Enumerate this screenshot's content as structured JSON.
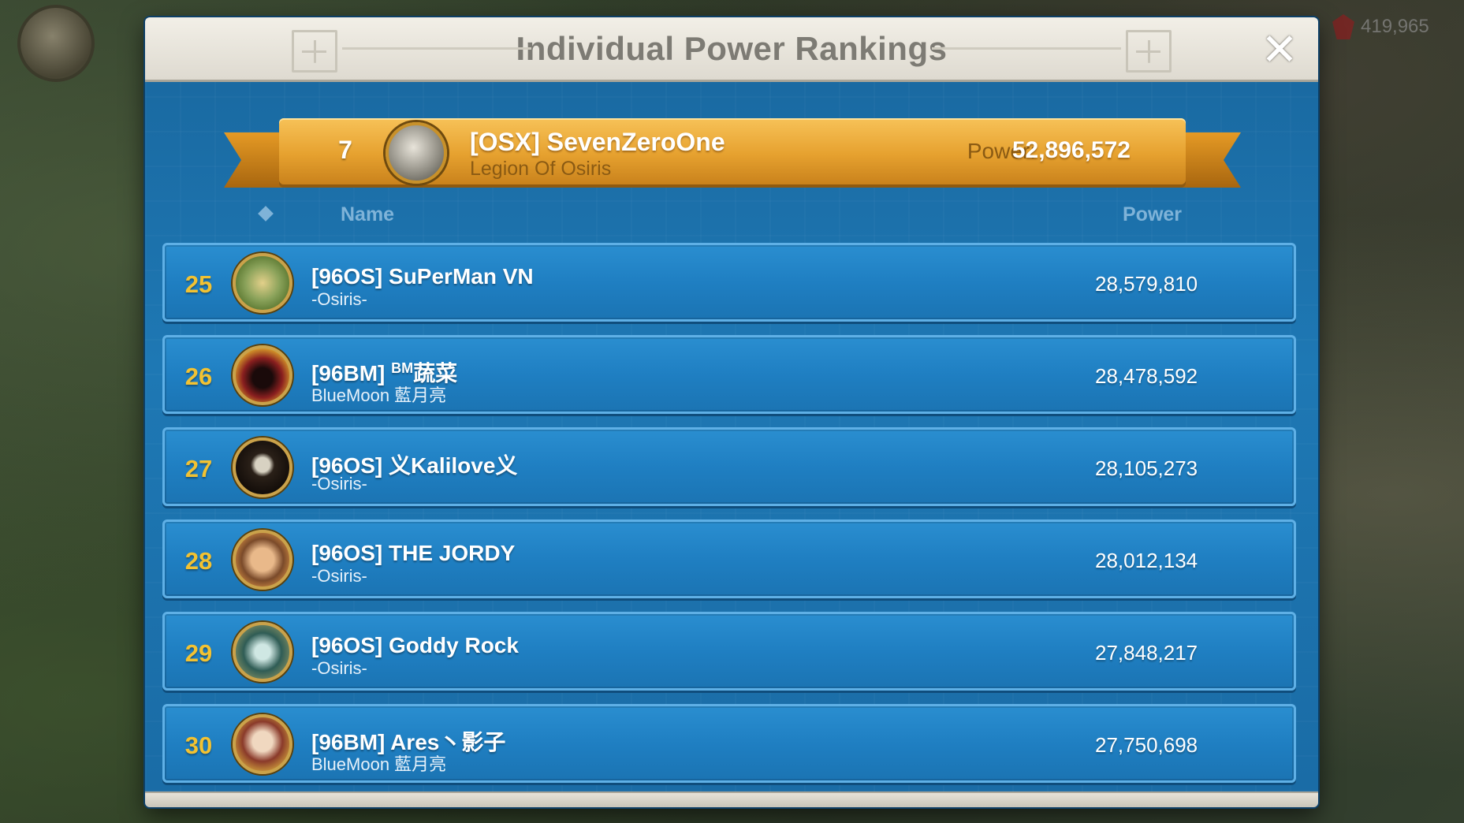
{
  "background": {
    "resource_value": "419,965",
    "resource_icon": "gem-icon"
  },
  "panel": {
    "title": "Individual Power Rankings",
    "close_icon": "close-icon",
    "close_glyph": "✕"
  },
  "my_rank": {
    "rank": "7",
    "name": "[OSX] SevenZeroOne",
    "alliance": "Legion Of Osiris",
    "power_label": "Power:",
    "power_value": "52,896,572"
  },
  "columns": {
    "rank_icon": "diamond-icon",
    "name": "Name",
    "power": "Power"
  },
  "rows": [
    {
      "rank": "25",
      "name": "[96OS] SuPerMan VN",
      "name_sup": "",
      "name_suffix": "",
      "alliance": "-Osiris-",
      "power": "28,579,810"
    },
    {
      "rank": "26",
      "name": "[96BM] ",
      "name_sup": "BM",
      "name_suffix": "蔬菜",
      "alliance": "BlueMoon 藍月亮",
      "power": "28,478,592"
    },
    {
      "rank": "27",
      "name": "[96OS] 义Kalilove义",
      "name_sup": "",
      "name_suffix": "",
      "alliance": "-Osiris-",
      "power": "28,105,273"
    },
    {
      "rank": "28",
      "name": "[96OS] THE JORDY",
      "name_sup": "",
      "name_suffix": "",
      "alliance": "-Osiris-",
      "power": "28,012,134"
    },
    {
      "rank": "29",
      "name": "[96OS] Goddy Rock",
      "name_sup": "",
      "name_suffix": "",
      "alliance": "-Osiris-",
      "power": "27,848,217"
    },
    {
      "rank": "30",
      "name": "[96BM] Ares丶影子",
      "name_sup": "",
      "name_suffix": "",
      "alliance": "BlueMoon 藍月亮",
      "power": "27,750,698"
    }
  ],
  "colors": {
    "panel_blue": "#1d6fa8",
    "row_blue": "#1f7fc2",
    "rank_gold": "#f2c232",
    "banner_gold": "#e6a12f"
  }
}
